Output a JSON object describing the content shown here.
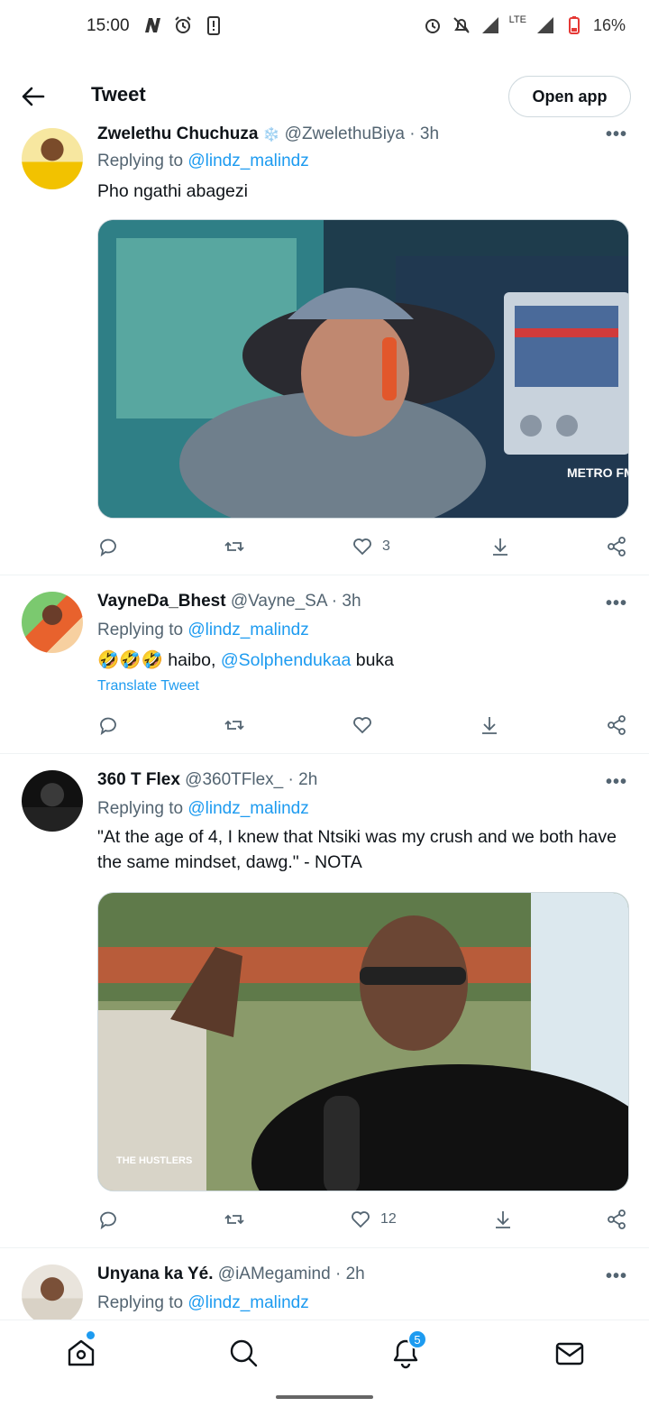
{
  "status_bar": {
    "time": "15:00",
    "network": "LTE",
    "battery": "16%"
  },
  "header": {
    "title": "Tweet",
    "open_app_label": "Open app"
  },
  "tweets": [
    {
      "name": "Zwelethu Chuchuza",
      "name_emoji": "❄️",
      "handle": "@ZwelethuBiya",
      "time": "3h",
      "replying_prefix": "Replying to",
      "replying_to": "@lindz_malindz",
      "text": "Pho ngathi abagezi",
      "likes": "3",
      "media_watermark": "METRO FM"
    },
    {
      "name": "VayneDa_Bhest",
      "handle": "@Vayne_SA",
      "time": "3h",
      "replying_prefix": "Replying to",
      "replying_to": "@lindz_malindz",
      "text_emoji": "🤣🤣🤣",
      "text_before": " haibo, ",
      "text_mention": "@Solphendukaa",
      "text_after": " buka",
      "translate": "Translate Tweet",
      "likes": ""
    },
    {
      "name": "360 T Flex",
      "handle": "@360TFlex_",
      "time": "2h",
      "replying_prefix": "Replying to",
      "replying_to": "@lindz_malindz",
      "text": "\"At the age of 4, I knew that Ntsiki was my crush and we both have the same mindset, dawg.\" - NOTA",
      "likes": "12",
      "media_watermark": "THE HUSTLERS"
    },
    {
      "name": "Unyana ka Yé.",
      "handle": "@iAMegamind",
      "time": "2h",
      "replying_prefix": "Replying to",
      "replying_to": "@lindz_malindz"
    }
  ],
  "bottom_nav": {
    "notifications_badge": "5"
  },
  "colors": {
    "accent": "#1d9bf0",
    "text": "#0f1419",
    "secondary": "#536471"
  }
}
